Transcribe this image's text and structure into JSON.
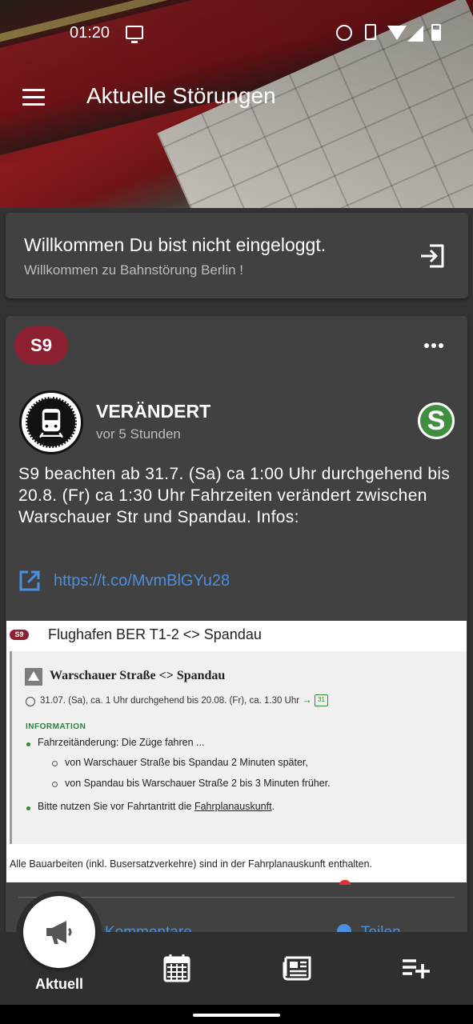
{
  "status_bar": {
    "time": "01:20",
    "icons": [
      "cast-icon",
      "alarm-icon",
      "vibrate-icon",
      "wifi-icon",
      "signal-icon",
      "battery-icon"
    ]
  },
  "app_bar": {
    "title": "Aktuelle Störungen",
    "menu_icon": "menu-icon"
  },
  "login_card": {
    "title": "Willkommen Du bist nicht eingeloggt.",
    "subtitle": "Willkommen zu Bahnstörung Berlin !",
    "icon": "login-icon"
  },
  "post": {
    "line_badge": "S9",
    "badge_color": "#8e2131",
    "more_icon": "more-horizontal-icon",
    "status": "VERÄNDERT",
    "time_ago": "vor 5 Stunden",
    "operator_logo": "S",
    "operator_logo_color": "#3f8f3f",
    "text": "S9 beachten ab 31.7. (Sa) ca 1:00 Uhr durchgehend bis 20.8. (Fr) ca 1:30 Uhr Fahrzeiten verändert zwischen Warschauer Str und Spandau. Infos:",
    "link": "https://t.co/MvmBlGYu28",
    "link_color": "#4a8fe0",
    "embed": {
      "badge": "S9",
      "route": "Flughafen BER T1-2 <> Spandau",
      "title": "Warschauer Straße <> Spandau",
      "date": "31.07. (Sa), ca. 1 Uhr durchgehend bis 20.08. (Fr), ca. 1.30 Uhr",
      "calendar_day": "31",
      "info_label": "INFORMATION",
      "bullet1": "Fahrzeitänderung: Die Züge fahren ...",
      "sub1": "von Warschauer Straße bis Spandau 2 Minuten später,",
      "sub2": "von Spandau bis Warschauer Straße 2 bis 3 Minuten früher.",
      "bullet2_prefix": "Bitte nutzen Sie vor Fahrtantritt die",
      "bullet2_link": "Fahrplanauskunft",
      "bullet2_suffix": ".",
      "footer": "Alle Bauarbeiten (inkl. Busersatzverkehre) sind in der Fahrplanauskunft enthalten."
    },
    "action_comment": "Kommentare",
    "action_share": "Teilen"
  },
  "bottom_nav": {
    "active_label": "Aktuell",
    "items": [
      "megaphone-icon",
      "calendar-icon",
      "newspaper-icon",
      "playlist-add-icon"
    ]
  }
}
